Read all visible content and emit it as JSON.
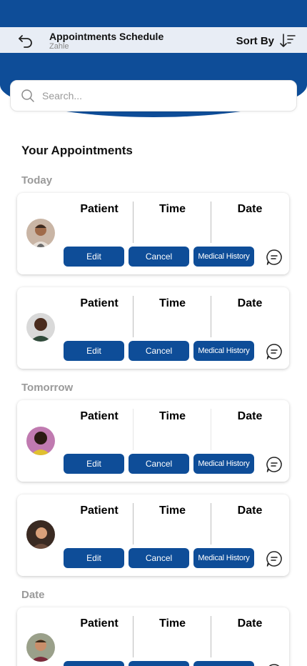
{
  "header": {
    "title": "Appointments Schedule",
    "subtitle": "Zahle",
    "sort_label": "Sort By",
    "back_icon": "back-arrow-icon",
    "sort_icon": "sort-descending-icon"
  },
  "search": {
    "placeholder": "Search..."
  },
  "section_title": "Your Appointments",
  "groups": [
    "Today",
    "Tomorrow",
    "Date"
  ],
  "columns": {
    "patient": "Patient",
    "time": "Time",
    "date": "Date"
  },
  "actions": {
    "edit": "Edit",
    "cancel": "Cancel",
    "history": "Medical History"
  },
  "colors": {
    "primary": "#0e4d98",
    "app_bar": "#e8edf5",
    "muted": "#9a9a9a"
  }
}
